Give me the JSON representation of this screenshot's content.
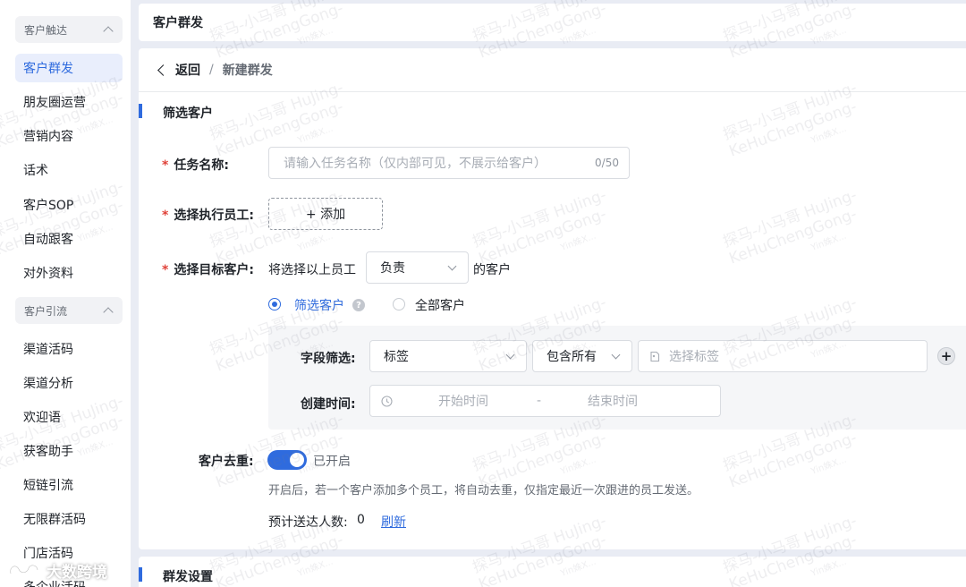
{
  "sidebar": {
    "group1": {
      "label": "客户触达"
    },
    "items1": [
      {
        "label": "客户群发",
        "active": true
      },
      {
        "label": "朋友圈运营"
      },
      {
        "label": "营销内容"
      },
      {
        "label": "话术"
      },
      {
        "label": "客户SOP"
      },
      {
        "label": "自动跟客"
      },
      {
        "label": "对外资料"
      }
    ],
    "group2": {
      "label": "客户引流"
    },
    "items2": [
      {
        "label": "渠道活码"
      },
      {
        "label": "渠道分析"
      },
      {
        "label": "欢迎语"
      },
      {
        "label": "获客助手"
      },
      {
        "label": "短链引流"
      },
      {
        "label": "无限群活码"
      },
      {
        "label": "门店活码"
      },
      {
        "label": "多企业活码"
      }
    ]
  },
  "header": {
    "title": "客户群发"
  },
  "breadcrumb": {
    "back": "返回",
    "separator": "/",
    "current": "新建群发"
  },
  "section1": {
    "title": "筛选客户"
  },
  "form": {
    "task_name": {
      "required_mark": "*",
      "label": "任务名称:",
      "placeholder": "请输入任务名称（仅内部可见，不展示给客户）",
      "counter": "0/50"
    },
    "staff": {
      "required_mark": "*",
      "label": "选择执行员工:",
      "add_button": "+ 添加"
    },
    "target": {
      "required_mark": "*",
      "label": "选择目标客户:",
      "prefix": "将选择以上员工",
      "select_value": "负责",
      "suffix": "的客户",
      "radio_filter": "筛选客户",
      "radio_all": "全部客户",
      "help": "?"
    },
    "field_filter": {
      "label": "字段筛选:",
      "field_value": "标签",
      "condition_value": "包含所有",
      "tag_placeholder": "选择标签",
      "add": "+"
    },
    "created_time": {
      "label": "创建时间:",
      "start_placeholder": "开始时间",
      "dash": "-",
      "end_placeholder": "结束时间"
    },
    "dedupe": {
      "label": "客户去重:",
      "toggle_state": "已开启",
      "description": "开启后，若一个客户添加多个员工，将自动去重，仅指定最近一次跟进的员工发送。"
    },
    "estimate": {
      "label": "预计送达人数:",
      "count": "0",
      "refresh": "刷新"
    }
  },
  "section2": {
    "title": "群发设置"
  },
  "watermark": {
    "line1": "探马-小马哥 HuJing-",
    "line2": "KeHuChengGong-",
    "line3": "Yin姝X..."
  },
  "brand": {
    "text": "大数跨境"
  },
  "colors": {
    "accent": "#2f6bde",
    "required": "#e0433a",
    "background": "#e9ecf4"
  }
}
